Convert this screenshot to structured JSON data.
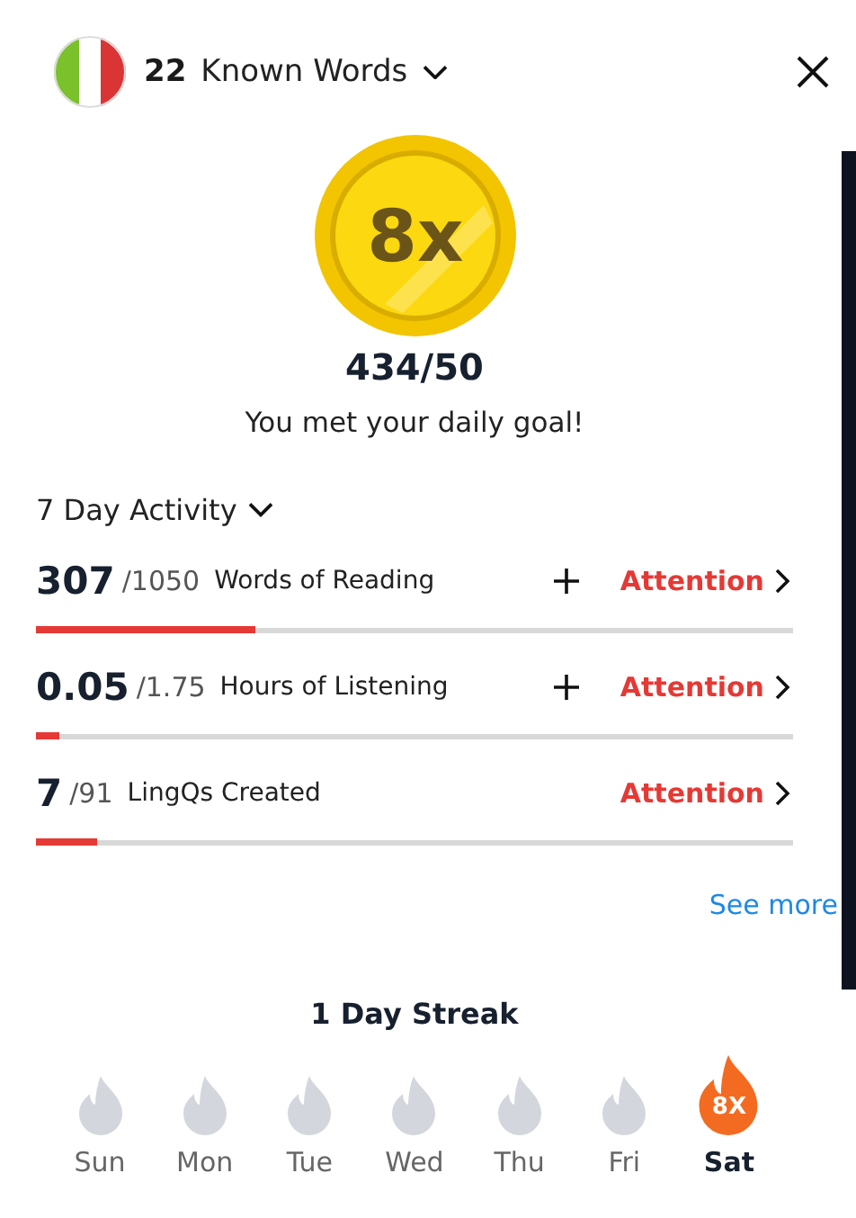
{
  "header": {
    "count": "22",
    "label": "Known Words"
  },
  "coin": {
    "text": "8x"
  },
  "goal": {
    "score": "434/50",
    "message": "You met your daily goal!"
  },
  "activity": {
    "title": "7 Day Activity",
    "rows": [
      {
        "value": "307",
        "target": "/1050",
        "label": "Words of Reading",
        "add_button": true,
        "status": "Attention",
        "level": 0.29
      },
      {
        "value": "0.05",
        "target": "/1.75",
        "label": "Hours of Listening",
        "add_button": true,
        "status": "Attention",
        "level": 0.03
      },
      {
        "value": "7",
        "target": "/91",
        "label": "LingQs Created",
        "add_button": false,
        "status": "Attention",
        "level": 0.08
      }
    ],
    "link": "See more"
  },
  "streak": {
    "title": "1 Day Streak",
    "days": [
      {
        "label": "Sun",
        "active": false
      },
      {
        "label": "Mon",
        "active": false
      },
      {
        "label": "Tue",
        "active": false
      },
      {
        "label": "Wed",
        "active": false
      },
      {
        "label": "Thu",
        "active": false
      },
      {
        "label": "Fri",
        "active": false
      },
      {
        "label": "Sat",
        "active": true,
        "badge": "8X"
      }
    ]
  }
}
